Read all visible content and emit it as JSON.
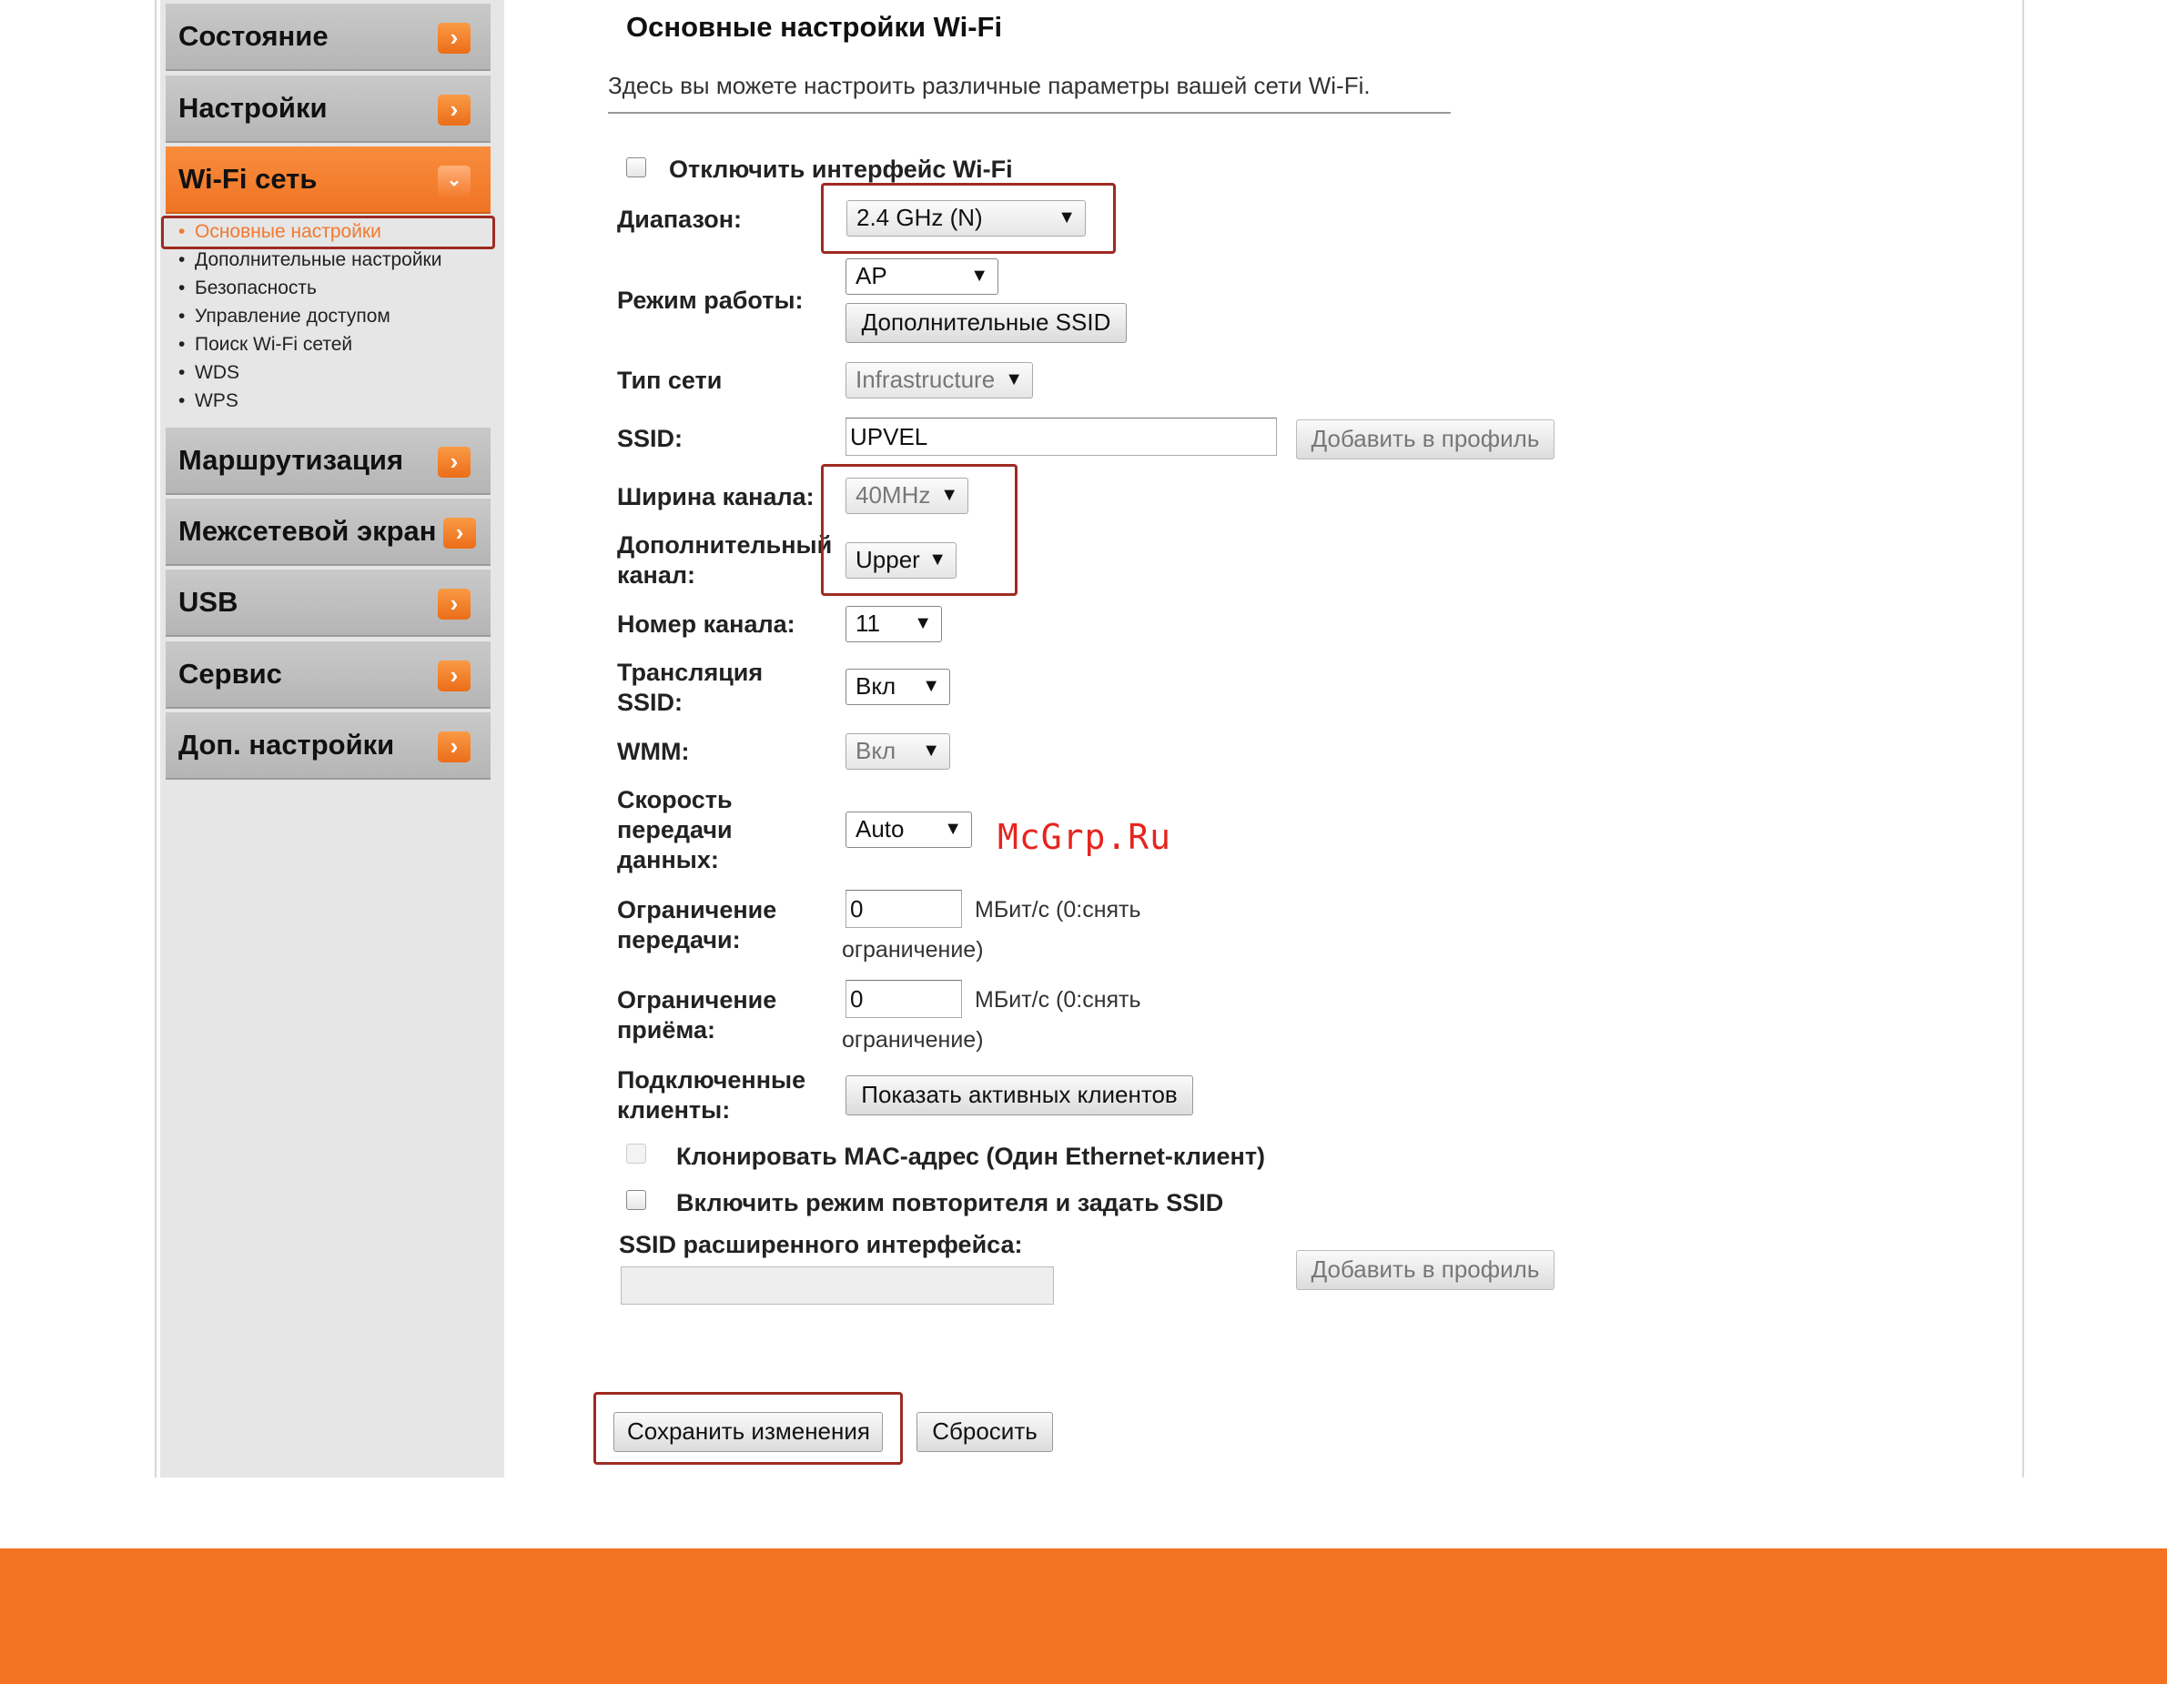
{
  "sidebar": {
    "menu": [
      {
        "label": "Состояние"
      },
      {
        "label": "Настройки"
      },
      {
        "label": "Wi-Fi сеть"
      },
      {
        "label": "Маршрутизация"
      },
      {
        "label": "Межсетевой экран"
      },
      {
        "label": "USB"
      },
      {
        "label": "Сервис"
      },
      {
        "label": "Доп. настройки"
      }
    ],
    "submenu": [
      {
        "label": "Основные настройки"
      },
      {
        "label": "Дополнительные настройки"
      },
      {
        "label": "Безопасность"
      },
      {
        "label": "Управление доступом"
      },
      {
        "label": "Поиск Wi-Fi сетей"
      },
      {
        "label": "WDS"
      },
      {
        "label": "WPS"
      }
    ]
  },
  "main": {
    "title": "Основные настройки Wi-Fi",
    "description": "Здесь вы можете настроить различные параметры вашей сети Wi-Fi.",
    "disable_wifi_label": "Отключить интерфейс Wi-Fi",
    "band": {
      "label": "Диапазон:",
      "value": "2.4 GHz (N)"
    },
    "mode": {
      "label": "Режим работы:",
      "value": "AP",
      "extra_ssid_button": "Дополнительные SSID"
    },
    "network_type": {
      "label": "Тип сети",
      "value": "Infrastructure"
    },
    "ssid": {
      "label": "SSID:",
      "value": "UPVEL",
      "add_profile_button": "Добавить в профиль"
    },
    "channel_width": {
      "label": "Ширина канала:",
      "value": "40MHz"
    },
    "extra_channel": {
      "label_line1": "Дополнительный",
      "label_line2": "канал:",
      "value": "Upper"
    },
    "channel_number": {
      "label": "Номер канала:",
      "value": "11"
    },
    "ssid_broadcast": {
      "label_line1": "Трансляция",
      "label_line2": "SSID:",
      "value": "Вкл"
    },
    "wmm": {
      "label": "WMM:",
      "value": "Вкл"
    },
    "data_rate": {
      "label_line1": "Скорость",
      "label_line2": "передачи",
      "label_line3": "данных:",
      "value": "Auto"
    },
    "tx_limit": {
      "label_line1": "Ограничение",
      "label_line2": "передачи:",
      "value": "0",
      "unit_line1": "МБит/с (0:снять",
      "unit_line2": "ограничение)"
    },
    "rx_limit": {
      "label_line1": "Ограничение",
      "label_line2": "приёма:",
      "value": "0",
      "unit_line1": "МБит/с (0:снять",
      "unit_line2": "ограничение)"
    },
    "clients": {
      "label_line1": "Подключенные",
      "label_line2": "клиенты:",
      "button": "Показать активных клиентов"
    },
    "clone_mac_label": "Клонировать MAC-адрес (Один Ethernet-клиент)",
    "repeater_label": "Включить режим повторителя и задать SSID",
    "ext_ssid": {
      "label": "SSID расширенного интерфейса:",
      "value": "",
      "add_profile_button": "Добавить в профиль"
    },
    "save_button": "Сохранить изменения",
    "reset_button": "Сбросить"
  },
  "watermark": "McGrp.Ru",
  "colors": {
    "accent": "#f27321",
    "highlight_box": "#9e2a22",
    "watermark": "#e5251f"
  },
  "icons": {
    "menu_arrow": "chevron-right-icon",
    "menu_arrow_open": "chevron-down-icon",
    "select_caret": "triangle-down-icon"
  }
}
